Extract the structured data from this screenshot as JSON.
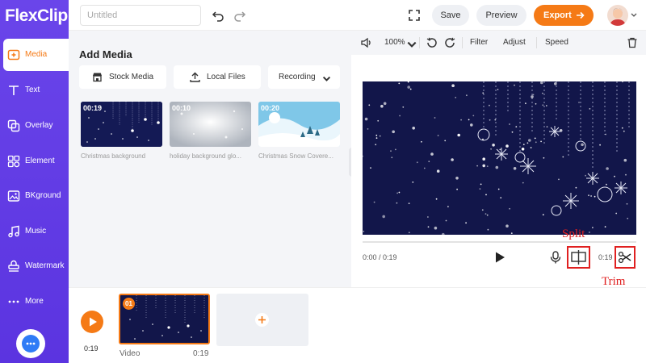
{
  "app": {
    "logo_text": "FlexClip"
  },
  "sidebar": {
    "items": [
      {
        "label": "Media",
        "icon": "media-plus-icon",
        "active": true
      },
      {
        "label": "Text",
        "icon": "text-t-icon"
      },
      {
        "label": "Overlay",
        "icon": "overlay-icon"
      },
      {
        "label": "Element",
        "icon": "element-icon"
      },
      {
        "label": "BKground",
        "icon": "background-icon"
      },
      {
        "label": "Music",
        "icon": "music-note-icon"
      },
      {
        "label": "Watermark",
        "icon": "watermark-icon"
      },
      {
        "label": "More",
        "icon": "more-dots-icon"
      }
    ],
    "chat_icon": "chat-bubble-icon"
  },
  "topbar": {
    "title_placeholder": "Untitled",
    "save_label": "Save",
    "preview_label": "Preview",
    "export_label": "Export",
    "export_icon": "arrow-right-icon"
  },
  "media": {
    "title": "Add Media",
    "buttons": {
      "stock": "Stock Media",
      "local": "Local Files",
      "recording": "Recording"
    },
    "items": [
      {
        "duration": "00:19",
        "caption": "Christmas background"
      },
      {
        "duration": "00:10",
        "caption": "holiday background glo..."
      },
      {
        "duration": "00:20",
        "caption": "Christmas Snow Covere..."
      }
    ]
  },
  "preview": {
    "zoom": "100%",
    "filter_label": "Filter",
    "adjust_label": "Adjust",
    "speed_label": "Speed",
    "time_current": "0:00 / 0:19",
    "time_end": "0:19",
    "annotation_split": "Split",
    "annotation_trim": "Trim"
  },
  "timeline": {
    "time": "0:19",
    "clip_number": "01",
    "clip_name": "Video",
    "clip_duration": "0:19"
  },
  "colors": {
    "brand_purple": "#5b34e0",
    "accent_orange": "#f57a16",
    "annotation_red": "#e02020",
    "video_navy": "#12164a"
  }
}
